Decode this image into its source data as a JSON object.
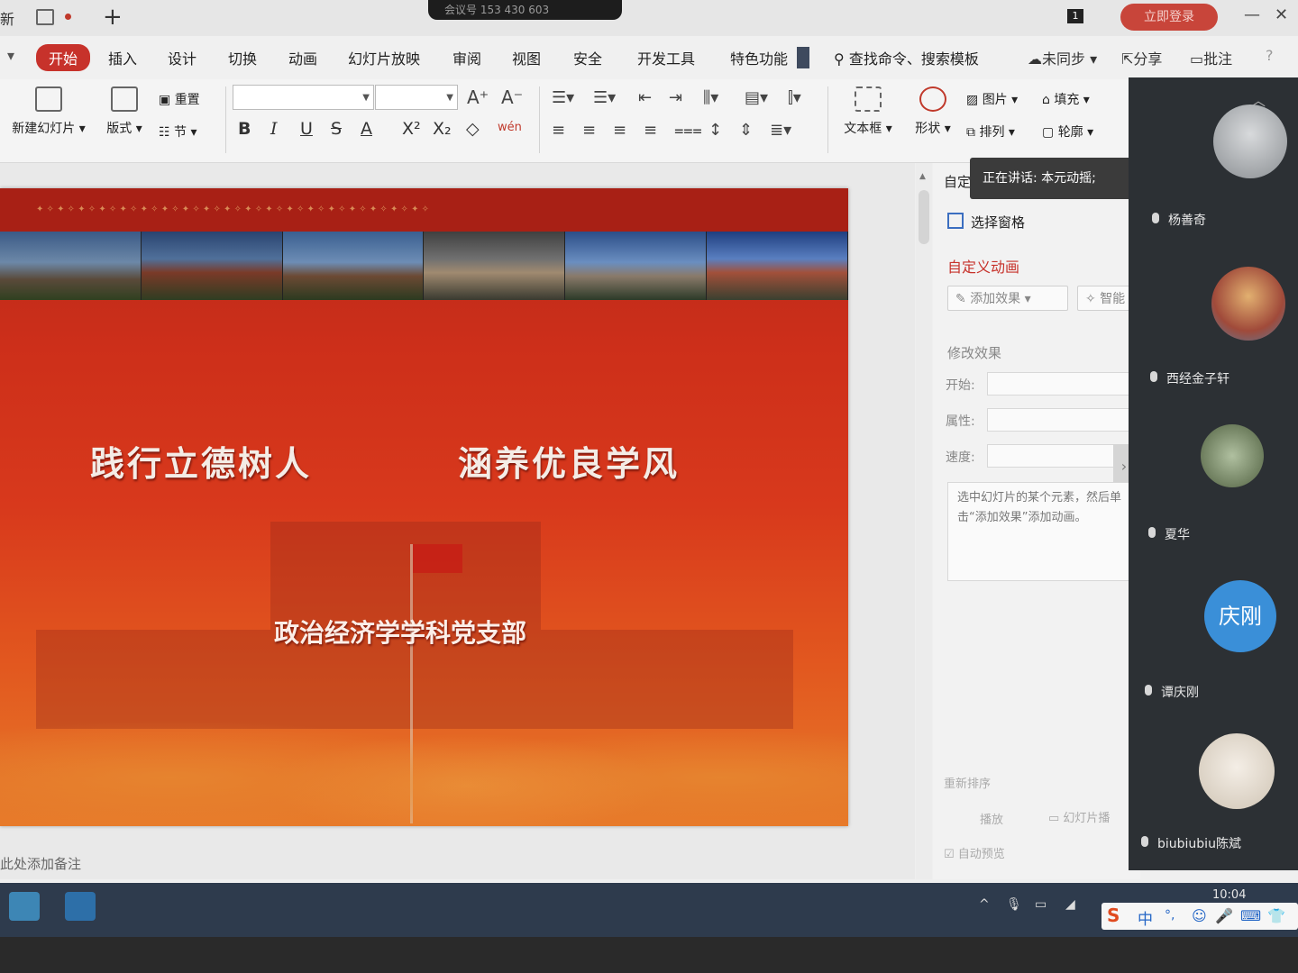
{
  "titlebar": {
    "tab_partial": "新",
    "new_tab_symbol": "+",
    "meeting_info": "会议号 153 430 603",
    "page_count_badge": "1",
    "login_label": "立即登录",
    "minimize": "—",
    "close": "✕"
  },
  "menu": {
    "items": [
      "开始",
      "插入",
      "设计",
      "切换",
      "动画",
      "幻灯片放映",
      "审阅",
      "视图",
      "安全",
      "开发工具",
      "特色功能"
    ],
    "search": "查找命令、搜索模板",
    "sync": "未同步",
    "share": "分享",
    "comment": "批注",
    "help": "?"
  },
  "ribbon": {
    "new_slide": "新建幻灯片",
    "layout": "版式",
    "reset": "重置",
    "section": "节",
    "font_name": "",
    "font_size": "",
    "grow": "A⁺",
    "shrink": "A⁻",
    "bold": "B",
    "italic": "I",
    "underline": "U",
    "strike": "S",
    "font_color": "A",
    "superscript": "X²",
    "subscript": "X₂",
    "clear": "◇",
    "pinyin": "wén",
    "textbox": "文本框",
    "shape": "形状",
    "picture": "图片",
    "arrange": "排列",
    "fill": "填充",
    "outline": "轮廓"
  },
  "slide": {
    "title_left": "践行立德树人",
    "title_right": "涵养优良学风",
    "subtitle": "政治经济学学科党支部"
  },
  "notes_placeholder": "此处添加备注",
  "pane": {
    "header": "自定",
    "tooltip": "正在讲话: 本元动摇;",
    "selection_pane": "选择窗格",
    "custom_animation": "自定义动画",
    "add_effect": "添加效果",
    "smart": "智能",
    "modify_effect": "修改效果",
    "start_label": "开始:",
    "property_label": "属性:",
    "speed_label": "速度:",
    "hint": "选中幻灯片的某个元素，然后单击“添加效果”添加动画。",
    "reorder": "重新排序",
    "play": "播放",
    "slideshow": "幻灯片播",
    "autopreview": "自动预览",
    "expand": "›"
  },
  "participants": [
    {
      "name": "杨善奇",
      "avatar_color": "#b8bcc0"
    },
    {
      "name": "西经金子轩",
      "avatar_color": "#c58a5a"
    },
    {
      "name": "夏华",
      "avatar_color": "#8aa07a"
    },
    {
      "name": "谭庆刚",
      "avatar_text": "庆刚",
      "avatar_color": "#3a8fd8"
    },
    {
      "name": "biubiubiu陈斌",
      "avatar_color": "#e6ddd0"
    }
  ],
  "taskbar": {
    "clock": "10:04",
    "ime_mode": "中",
    "tray_up": "^"
  }
}
